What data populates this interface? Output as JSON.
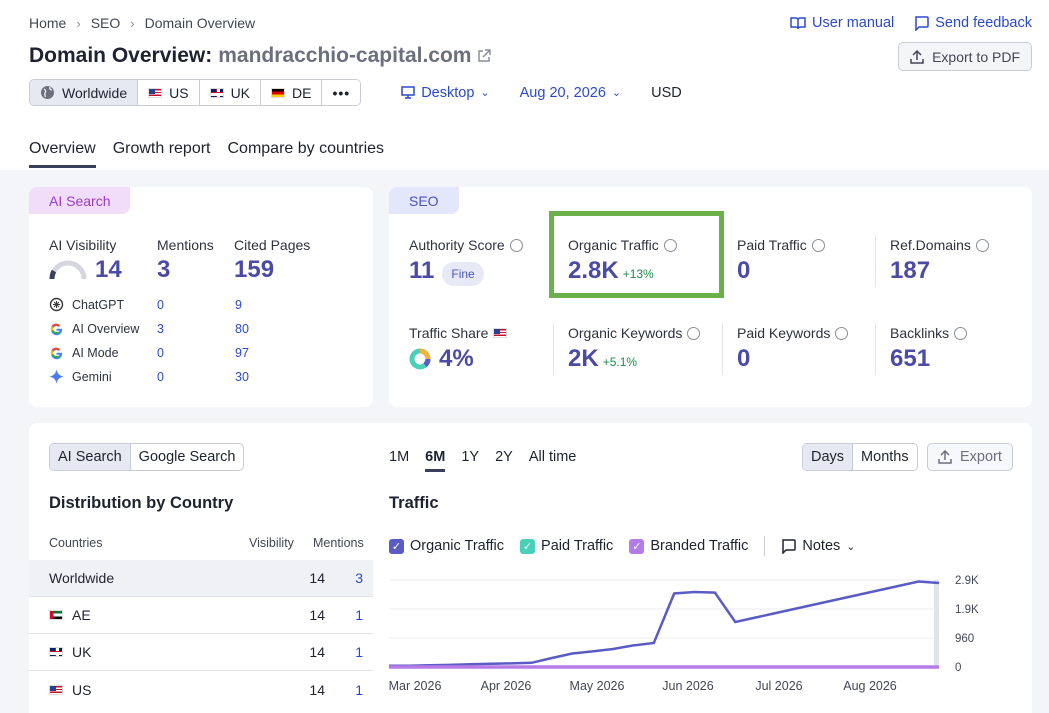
{
  "breadcrumb": [
    "Home",
    "SEO",
    "Domain Overview"
  ],
  "top_links": {
    "manual": "User manual",
    "feedback": "Send feedback"
  },
  "title": {
    "prefix": "Domain Overview:",
    "domain": "mandracchio-capital.com"
  },
  "export_pdf": "Export to PDF",
  "databases": [
    "Worldwide",
    "US",
    "UK",
    "DE"
  ],
  "device": "Desktop",
  "date": "Aug 20, 2026",
  "currency": "USD",
  "tabs": [
    "Overview",
    "Growth report",
    "Compare by countries"
  ],
  "ai_card": {
    "label": "AI Search",
    "visibility_label": "AI Visibility",
    "visibility": "14",
    "mentions_label": "Mentions",
    "mentions": "3",
    "cited_label": "Cited Pages",
    "cited": "159",
    "rows": [
      {
        "name": "ChatGPT",
        "mentions": "0",
        "cited": "9"
      },
      {
        "name": "AI Overview",
        "mentions": "3",
        "cited": "80"
      },
      {
        "name": "AI Mode",
        "mentions": "0",
        "cited": "97"
      },
      {
        "name": "Gemini",
        "mentions": "0",
        "cited": "30"
      }
    ]
  },
  "seo_card": {
    "label": "SEO",
    "authority_label": "Authority Score",
    "authority": "11",
    "authority_badge": "Fine",
    "organic_label": "Organic Traffic",
    "organic": "2.8K",
    "organic_delta": "+13%",
    "paid_label": "Paid Traffic",
    "paid": "0",
    "ref_label": "Ref.Domains",
    "ref": "187",
    "share_label": "Traffic Share",
    "share": "4%",
    "okw_label": "Organic Keywords",
    "okw": "2K",
    "okw_delta": "+5.1%",
    "pkw_label": "Paid Keywords",
    "pkw": "0",
    "bl_label": "Backlinks",
    "bl": "651"
  },
  "bottom": {
    "search_toggle": [
      "AI Search",
      "Google Search"
    ],
    "periods": [
      "1M",
      "6M",
      "1Y",
      "2Y",
      "All time"
    ],
    "granularity": [
      "Days",
      "Months"
    ],
    "export": "Export",
    "dist_title": "Distribution by Country",
    "cols": [
      "Countries",
      "Visibility",
      "Mentions"
    ],
    "rows": [
      {
        "country": "Worldwide",
        "visibility": "14",
        "mentions": "3"
      },
      {
        "country": "AE",
        "visibility": "14",
        "mentions": "1"
      },
      {
        "country": "UK",
        "visibility": "14",
        "mentions": "1"
      },
      {
        "country": "US",
        "visibility": "14",
        "mentions": "1"
      }
    ],
    "traffic_title": "Traffic",
    "legend": [
      "Organic Traffic",
      "Paid Traffic",
      "Branded Traffic"
    ],
    "notes": "Notes"
  },
  "colors": {
    "organic": "#5b5bc4",
    "paid": "#4ad0b8",
    "branded": "#b57be6",
    "highlight": "#6bb04a"
  },
  "chart_data": {
    "type": "line",
    "x_ticks": [
      "Mar 2026",
      "Apr 2026",
      "May 2026",
      "Jun 2026",
      "Jul 2026",
      "Aug 2026"
    ],
    "y_ticks": [
      "0",
      "960",
      "1.9K",
      "2.9K"
    ],
    "ylim": [
      0,
      2900
    ],
    "series": [
      {
        "name": "Organic Traffic",
        "values": [
          40,
          45,
          55,
          70,
          90,
          110,
          120,
          140,
          300,
          450,
          520,
          600,
          720,
          800,
          2450,
          2500,
          2480,
          1500,
          1650,
          1800,
          1950,
          2100,
          2250,
          2400,
          2550,
          2700,
          2850,
          2800
        ]
      },
      {
        "name": "Paid Traffic",
        "values": [
          0,
          0,
          0,
          0,
          0,
          0,
          0,
          0,
          0,
          0,
          0,
          0,
          0,
          0,
          0,
          0,
          0,
          0,
          0,
          0,
          0,
          0,
          0,
          0,
          0,
          0,
          0,
          0
        ]
      }
    ]
  }
}
